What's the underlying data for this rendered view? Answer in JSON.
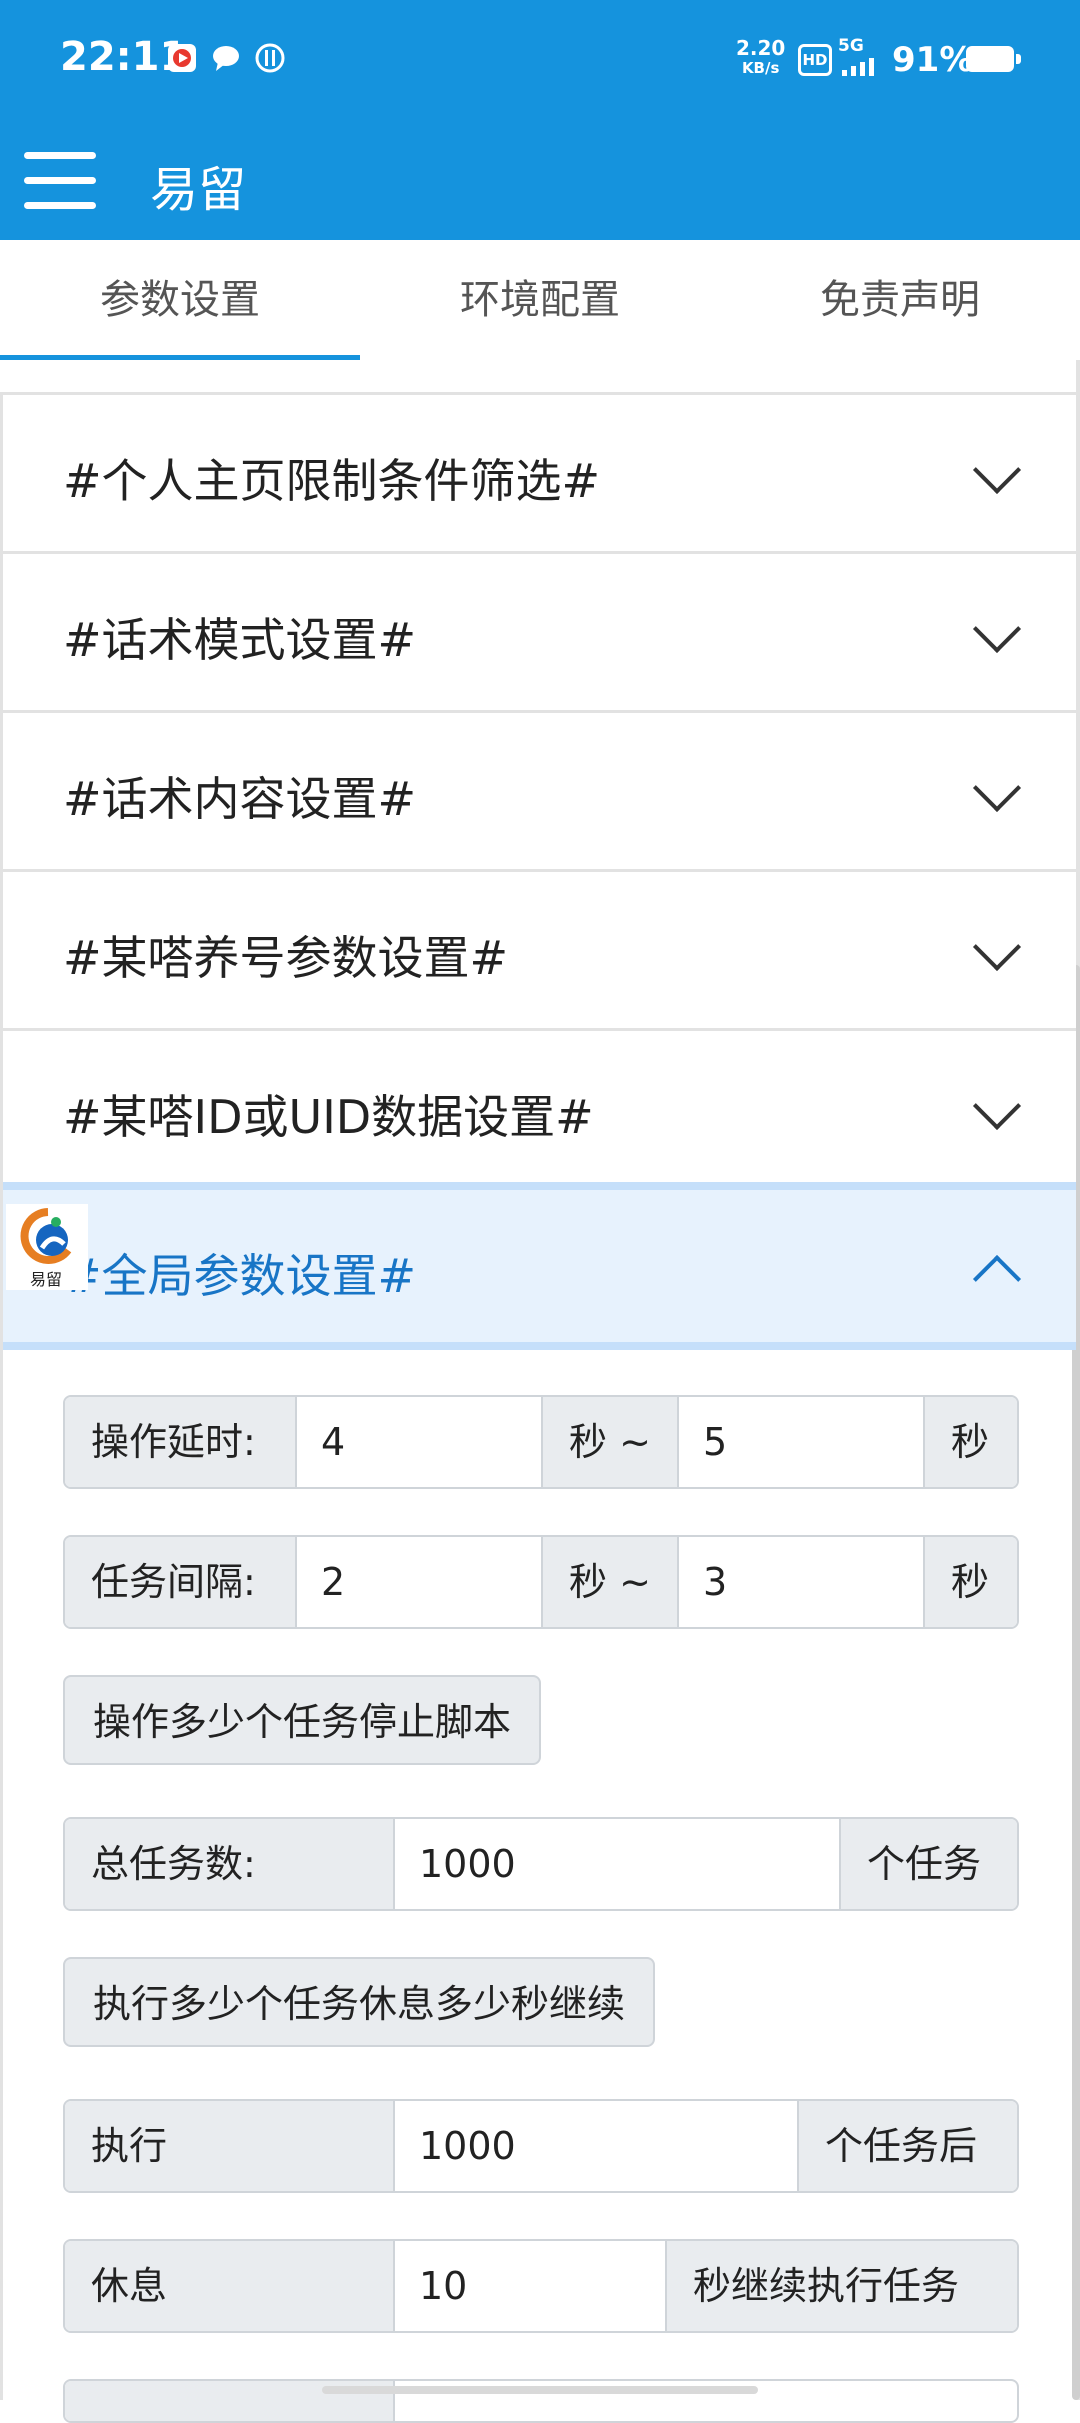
{
  "status_bar": {
    "time": "22:11",
    "speed_value": "2.20",
    "speed_unit": "KB/s",
    "hd": "HD",
    "network": "5G",
    "battery": "91%"
  },
  "app_bar": {
    "title": "易留"
  },
  "tabs": [
    {
      "label": "参数设置",
      "active": true
    },
    {
      "label": "环境配置",
      "active": false
    },
    {
      "label": "免责声明",
      "active": false
    }
  ],
  "sections": [
    {
      "title": "#个人主页限制条件筛选#"
    },
    {
      "title": "#话术模式设置#"
    },
    {
      "title": "#话术内容设置#"
    },
    {
      "title": "#某嗒养号参数设置#"
    },
    {
      "title": "#某嗒ID或UID数据设置#"
    },
    {
      "title": "#全局参数设置#"
    }
  ],
  "logo": {
    "text": "易留"
  },
  "global_params": {
    "op_delay": {
      "label": "操作延时:",
      "min": "4",
      "mid_unit": "秒 ~",
      "max": "5",
      "unit": "秒"
    },
    "task_interval": {
      "label": "任务间隔:",
      "min": "2",
      "mid_unit": "秒 ~",
      "max": "3",
      "unit": "秒"
    },
    "stop_button": "操作多少个任务停止脚本",
    "total_tasks": {
      "label": "总任务数:",
      "value": "1000",
      "unit": "个任务"
    },
    "rest_button": "执行多少个任务休息多少秒继续",
    "execute": {
      "label": "执行",
      "value": "1000",
      "unit": "个任务后"
    },
    "rest": {
      "label": "休息",
      "value": "10",
      "unit": "秒继续执行任务"
    }
  },
  "colors": {
    "primary": "#1593dd",
    "active_text": "#1875c6",
    "active_bg": "#e7f2fd",
    "addon_bg": "#e9ecef"
  }
}
